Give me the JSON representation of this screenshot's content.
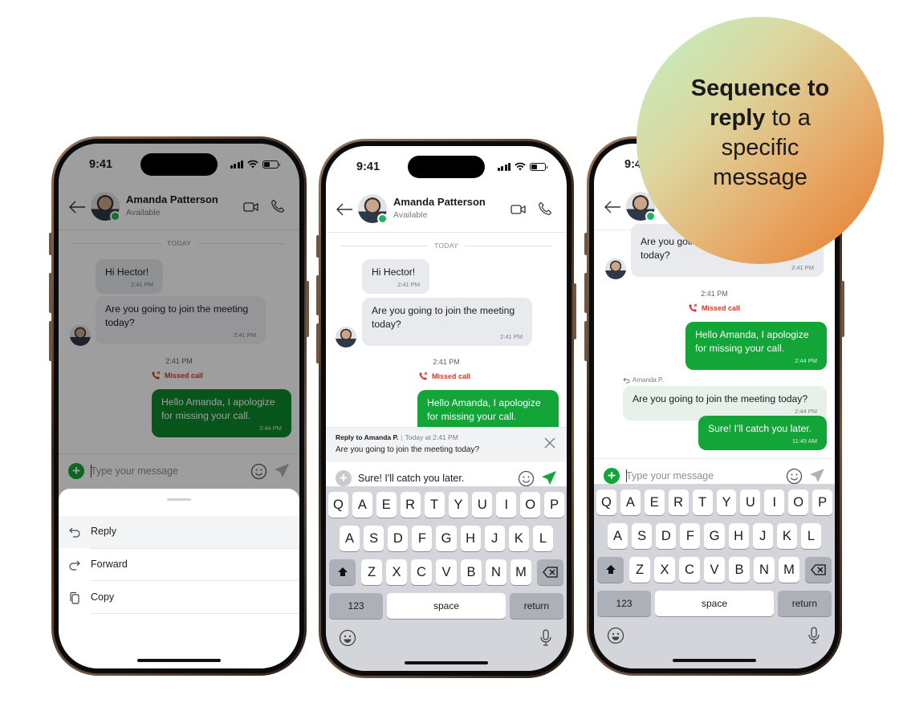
{
  "callout": {
    "bold_line": "Sequence to",
    "bold_word": "reply",
    "rest_line2": " to a",
    "line3": "specific",
    "line4": "message"
  },
  "colors": {
    "brand_green": "#13a538",
    "missed_call_red": "#d33a2c",
    "presence_green": "#1fb35a"
  },
  "status_bar": {
    "time": "9:41"
  },
  "contact": {
    "name": "Amanda Patterson",
    "status": "Available"
  },
  "icons": {
    "back": "arrow-left-icon",
    "video": "video-camera-icon",
    "call": "phone-icon",
    "add": "plus-circle-icon",
    "emoji": "smiley-icon",
    "send": "paper-plane-icon",
    "missed_call": "missed-call-icon",
    "reply": "reply-arrow-icon",
    "forward": "forward-arrow-icon",
    "copy": "copy-icon",
    "close": "close-x-icon",
    "shift": "shift-arrow-icon",
    "backspace": "backspace-icon",
    "mic": "microphone-icon"
  },
  "day_separator": "TODAY",
  "messages": {
    "hi": {
      "text": "Hi Hector!",
      "time": "2:41 PM"
    },
    "question": {
      "text": "Are you going to join the meeting today?",
      "time": "2:41 PM"
    },
    "call_time": "2:41 PM",
    "missed_call": "Missed call",
    "apology": {
      "text": "Hello Amanda, I apologize for missing your call.",
      "time": "2:44 PM"
    },
    "quoted_reply": {
      "author": "Amanda P.",
      "text": "Are you going to join the meeting today?",
      "time": "2:44 PM"
    },
    "answer": {
      "text": "Sure! I'll catch you later.",
      "time": "11:45 AM"
    }
  },
  "composer": {
    "placeholder": "Type your message",
    "draft_value": "Sure! I'll catch you later."
  },
  "reply_preview": {
    "label": "Reply to Amanda P.",
    "when": "Today at 2:41 PM",
    "quoted": "Are you going to join the meeting today?"
  },
  "action_sheet": {
    "items": [
      {
        "label": "Reply",
        "icon": "reply-arrow-icon",
        "highlighted": true
      },
      {
        "label": "Forward",
        "icon": "forward-arrow-icon",
        "highlighted": false
      },
      {
        "label": "Copy",
        "icon": "copy-icon",
        "highlighted": false
      }
    ]
  },
  "keyboard": {
    "row1": [
      "Q",
      "A",
      "E",
      "R",
      "T",
      "Y",
      "U",
      "I",
      "O",
      "P"
    ],
    "row2": [
      "A",
      "S",
      "D",
      "F",
      "G",
      "H",
      "J",
      "K",
      "L"
    ],
    "row3": [
      "Z",
      "X",
      "C",
      "V",
      "B",
      "N",
      "M"
    ],
    "numbers": "123",
    "space": "space",
    "return": "return"
  }
}
